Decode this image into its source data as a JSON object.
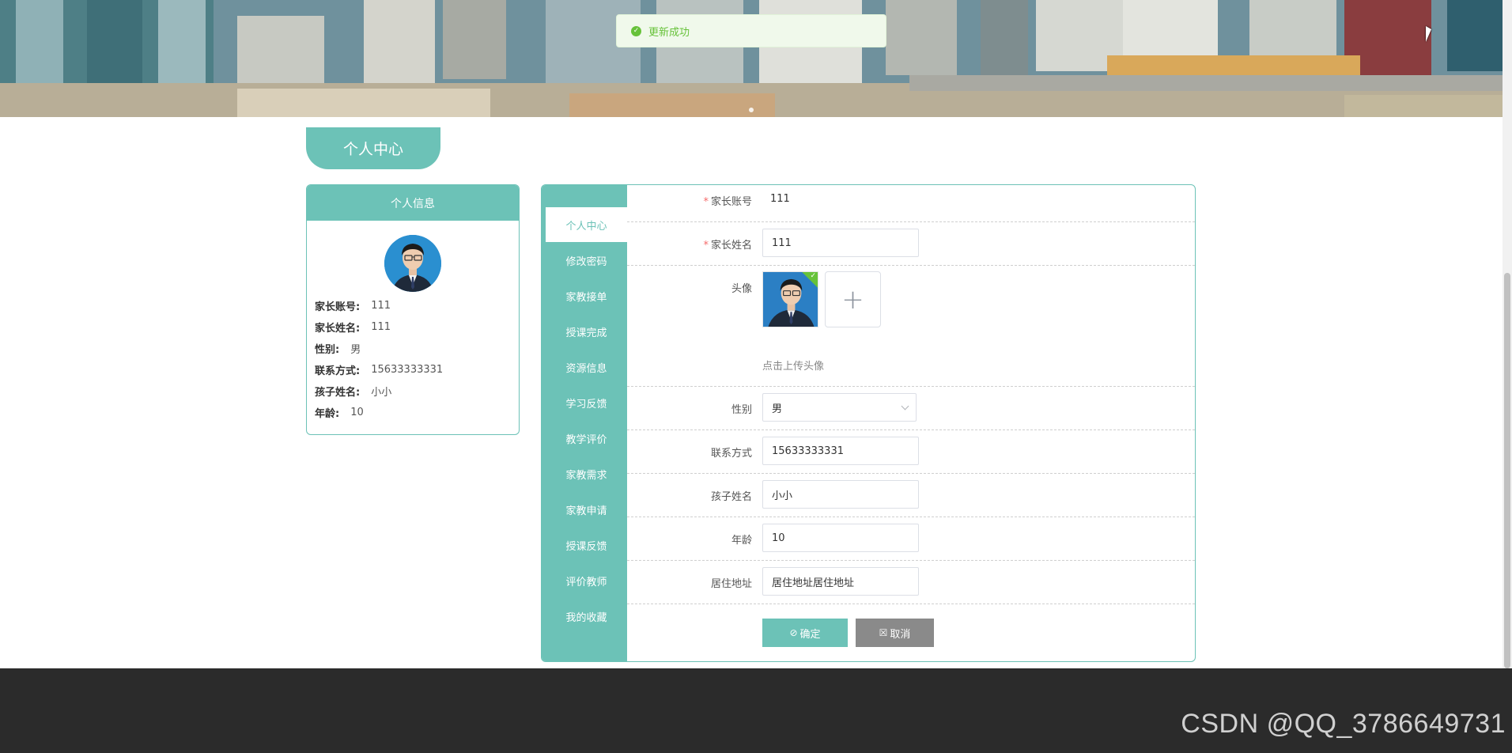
{
  "toast": {
    "message": "更新成功"
  },
  "title_tab": "个人中心",
  "info_card": {
    "header": "个人信息",
    "rows": [
      {
        "label": "家长账号:",
        "value": "111"
      },
      {
        "label": "家长姓名:",
        "value": "111"
      },
      {
        "label": "性别:",
        "value": "男"
      },
      {
        "label": "联系方式:",
        "value": "15633333331"
      },
      {
        "label": "孩子姓名:",
        "value": "小小"
      },
      {
        "label": "年龄:",
        "value": "10"
      }
    ]
  },
  "menu": {
    "active_index": 0,
    "items": [
      "个人中心",
      "修改密码",
      "家教接单",
      "授课完成",
      "资源信息",
      "学习反馈",
      "教学评价",
      "家教需求",
      "家教申请",
      "授课反馈",
      "评价教师",
      "我的收藏"
    ]
  },
  "form": {
    "account": {
      "label": "家长账号",
      "value": "111",
      "required": true
    },
    "name": {
      "label": "家长姓名",
      "value": "111",
      "required": true
    },
    "avatar": {
      "label": "头像",
      "upload_hint": "点击上传头像",
      "upload_icon": "plus-icon"
    },
    "gender": {
      "label": "性别",
      "value": "男"
    },
    "phone": {
      "label": "联系方式",
      "value": "15633333331"
    },
    "child_name": {
      "label": "孩子姓名",
      "value": "小小"
    },
    "age": {
      "label": "年龄",
      "value": "10"
    },
    "address": {
      "label": "居住地址",
      "value": "居住地址居住地址"
    },
    "confirm_label": "确定",
    "cancel_label": "取消"
  },
  "watermark": "CSDN @QQ_3786649731",
  "colors": {
    "accent": "#6cc2b7",
    "success": "#67c23a",
    "footer": "#2b2b2b",
    "required": "#f56c6c"
  }
}
